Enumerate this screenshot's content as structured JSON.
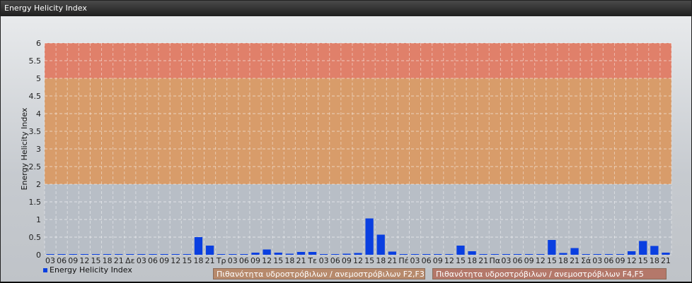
{
  "window": {
    "title": "Energy Helicity Index"
  },
  "legend": {
    "series_label": "Energy Helicity Index"
  },
  "bands": {
    "band1_label": "Πιθανότητα υδροστρόβιλων / ανεμοστρόβιλων F2,F3",
    "band2_label": "Πιθανότητα υδροστρόβιλων / ανεμοστρόβιλων F4,F5"
  },
  "colors": {
    "bar": "#0a3fe0",
    "band_low": "#b8bec6",
    "band_mid": "#d89c6a",
    "band_high": "#e0806a"
  },
  "chart_data": {
    "type": "bar",
    "ylabel": "Energy Helicity Index",
    "xlabel": "",
    "ylim": [
      0,
      6
    ],
    "yticks": [
      "0",
      "0.5",
      "1",
      "1.5",
      "2",
      "2.5",
      "3",
      "3.5",
      "4",
      "4.5",
      "5",
      "5.5",
      "6"
    ],
    "grid": true,
    "bands": [
      {
        "from": 0,
        "to": 2,
        "color": "#b8bec6"
      },
      {
        "from": 2,
        "to": 5,
        "color": "#d89c6a"
      },
      {
        "from": 5,
        "to": 6,
        "color": "#e0806a"
      }
    ],
    "categories": [
      "03",
      "06",
      "09",
      "12",
      "15",
      "18",
      "21",
      "Δε",
      "03",
      "06",
      "09",
      "12",
      "15",
      "18",
      "21",
      "Τρ",
      "03",
      "06",
      "09",
      "12",
      "15",
      "18",
      "21",
      "Τε",
      "03",
      "06",
      "09",
      "12",
      "15",
      "18",
      "21",
      "Πέ",
      "03",
      "06",
      "09",
      "12",
      "15",
      "18",
      "21",
      "Πα",
      "03",
      "06",
      "09",
      "12",
      "15",
      "18",
      "21",
      "Σά",
      "03",
      "06",
      "09",
      "12",
      "15",
      "18",
      "21"
    ],
    "series": [
      {
        "name": "Energy Helicity Index",
        "values": [
          0.01,
          0.01,
          0.01,
          0.01,
          0.02,
          0.01,
          0.01,
          0.01,
          0.01,
          0.01,
          0.01,
          0.02,
          0.02,
          0.5,
          0.26,
          0.02,
          0.02,
          0.02,
          0.06,
          0.15,
          0.06,
          0.03,
          0.08,
          0.08,
          0.02,
          0.02,
          0.03,
          0.05,
          1.03,
          0.57,
          0.09,
          0.01,
          0.01,
          0.01,
          0.02,
          0.02,
          0.26,
          0.1,
          0.01,
          0.01,
          0.01,
          0.01,
          0.01,
          0.02,
          0.42,
          0.05,
          0.19,
          0.02,
          0.02,
          0.01,
          0.02,
          0.1,
          0.39,
          0.25,
          0.06
        ]
      }
    ]
  }
}
